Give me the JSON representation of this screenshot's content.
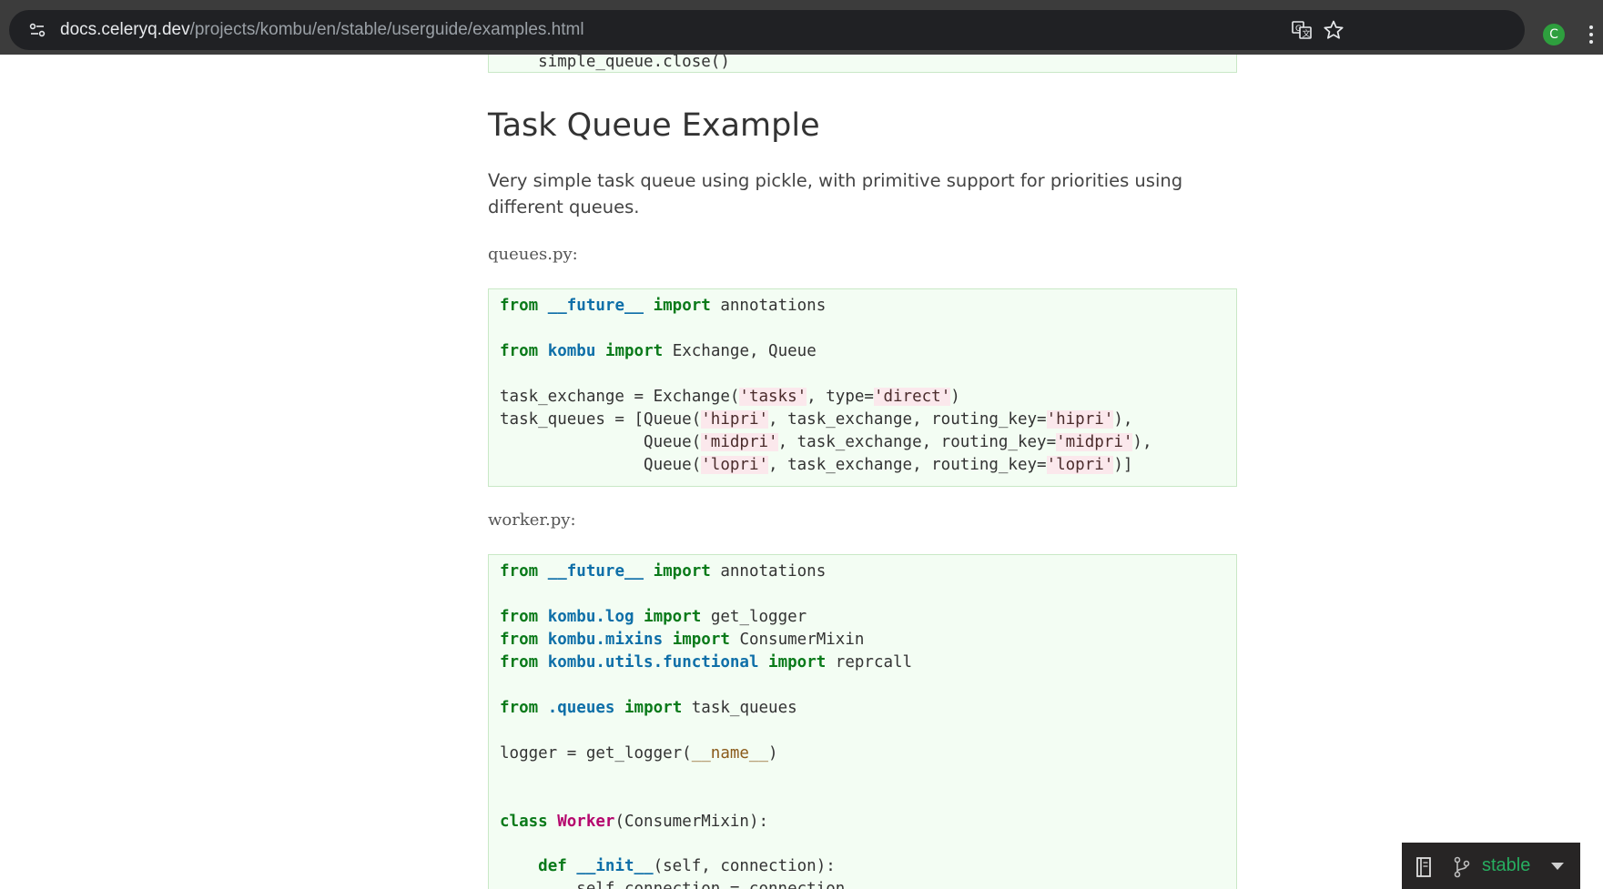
{
  "browser": {
    "url_host": "docs.celeryq.dev",
    "url_path": "/projects/kombu/en/stable/userguide/examples.html",
    "profile_initial": "C"
  },
  "page": {
    "prev_code_tail": "    simple_queue.close()",
    "heading": "Task Queue Example",
    "intro": "Very simple task queue using pickle, with primitive support for priorities using different queues.",
    "file1": "queues.py:",
    "file2": "worker.py:"
  },
  "code1": [
    [
      "from",
      " ",
      "__future__",
      " ",
      "import",
      " annotations"
    ],
    [
      "from",
      " ",
      "kombu",
      " ",
      "import",
      " Exchange, Queue"
    ],
    [
      "task_exchange = Exchange(",
      "'tasks'",
      ", type=",
      "'direct'",
      ")"
    ],
    [
      "task_queues = [Queue(",
      "'hipri'",
      ", task_exchange, routing_key=",
      "'hipri'",
      "),"
    ],
    [
      "               Queue(",
      "'midpri'",
      ", task_exchange, routing_key=",
      "'midpri'",
      "),"
    ],
    [
      "               Queue(",
      "'lopri'",
      ", task_exchange, routing_key=",
      "'lopri'",
      ")]"
    ]
  ],
  "code2": [
    [
      "from",
      " ",
      "__future__",
      " ",
      "import",
      " annotations"
    ],
    [
      "from",
      " ",
      "kombu.log",
      " ",
      "import",
      " get_logger"
    ],
    [
      "from",
      " ",
      "kombu.mixins",
      " ",
      "import",
      " ConsumerMixin"
    ],
    [
      "from",
      " ",
      "kombu.utils.functional",
      " ",
      "import",
      " reprcall"
    ],
    [
      "from",
      " ",
      ".queues",
      " ",
      "import",
      " task_queues"
    ],
    [
      "logger = get_logger(",
      "__name__",
      ")"
    ],
    [
      "class",
      " ",
      "Worker",
      "(ConsumerMixin):"
    ],
    [
      "    ",
      "def",
      " ",
      "__init__",
      "(self, connection):"
    ],
    [
      "        self.connection = connection"
    ]
  ],
  "rtd_flyout": {
    "version_label": "stable"
  }
}
